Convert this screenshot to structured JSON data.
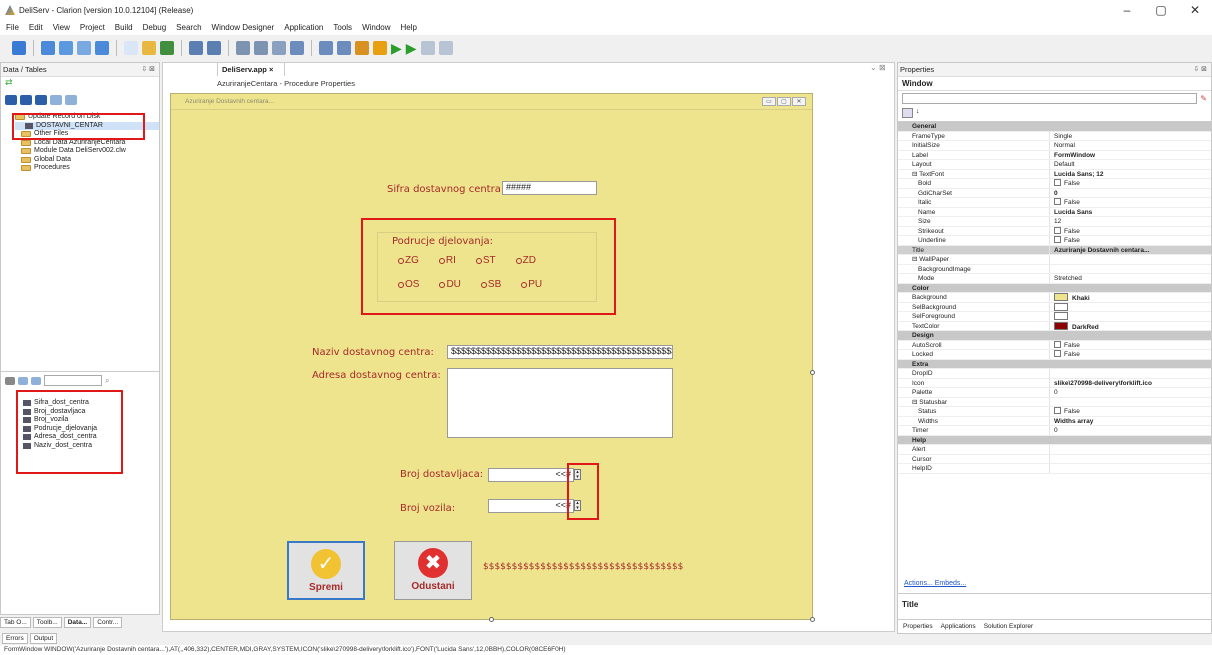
{
  "window": {
    "title": "DeliServ - Clarion [version 10.0.12104] (Release)",
    "minimize": "–",
    "maximize": "▢",
    "close": "✕"
  },
  "menu": [
    "File",
    "Edit",
    "View",
    "Project",
    "Build",
    "Debug",
    "Search",
    "Window Designer",
    "Application",
    "Tools",
    "Window",
    "Help"
  ],
  "left_panel": {
    "title": "Data / Tables",
    "tree": [
      "Update Record on Disk",
      "DOSTAVNI_CENTAR",
      "Other Files",
      "Local Data AzuriranjeCentara",
      "Module Data DeliServ002.clw",
      "Global Data",
      "Procedures"
    ],
    "fields": [
      "Sifra_dost_centra",
      "Broj_dostavljaca",
      "Broj_vozila",
      "Podrucje_djelovanja",
      "Adresa_dost_centra",
      "Naziv_dost_centra"
    ],
    "bottom_tabs": [
      "Tab O...",
      "Toolb...",
      "Data...",
      "Contr..."
    ]
  },
  "document": {
    "tab_label": "DeliServ.app",
    "tab_close": "×",
    "breadcrumb": "AzuriranjeCentara - Procedure Properties"
  },
  "form": {
    "title": "Azuriranje Dostavnih centara...",
    "sifra_label": "Sifra dostavnog centra:",
    "sifra_value": "#####",
    "group_label": "Podrucje djelovanja:",
    "radios_row1": [
      "ZG",
      "RI",
      "ST",
      "ZD"
    ],
    "radios_row2": [
      "OS",
      "DU",
      "SB",
      "PU"
    ],
    "naziv_label": "Naziv dostavnog centra:",
    "naziv_value": "$$$$$$$$$$$$$$$$$$$$$$$$$$$$$$$$$$$$$$$$$$$$$$$$$$$$$$$$$$$$$",
    "adresa_label": "Adresa dostavnog centra:",
    "broj_dostavljaca_label": "Broj dostavljaca:",
    "broj_dostavljaca_value": "<<#",
    "broj_vozila_label": "Broj vozila:",
    "broj_vozila_value": "<<#",
    "save_label": "Spremi",
    "cancel_label": "Odustani",
    "string_placeholder": "$$$$$$$$$$$$$$$$$$$$$$$$$$$$$$$$$$$"
  },
  "properties": {
    "title": "Properties",
    "object": "Window",
    "rows": [
      {
        "n": "General",
        "cat": true
      },
      {
        "n": "FrameType",
        "v": "Single"
      },
      {
        "n": "InitialSize",
        "v": "Normal"
      },
      {
        "n": "Label",
        "v": "FormWindow",
        "b": true
      },
      {
        "n": "Layout",
        "v": "Default"
      },
      {
        "n": "⊟ TextFont",
        "v": "Lucida Sans; 12",
        "b": true
      },
      {
        "n": "Bold",
        "v": "False",
        "cb": true,
        "ind": true
      },
      {
        "n": "GdiCharSet",
        "v": "0",
        "b": true,
        "ind": true
      },
      {
        "n": "Italic",
        "v": "False",
        "cb": true,
        "ind": true
      },
      {
        "n": "Name",
        "v": "Lucida Sans",
        "b": true,
        "ind": true
      },
      {
        "n": "Size",
        "v": "12",
        "ind": true
      },
      {
        "n": "Strikeout",
        "v": "False",
        "cb": true,
        "ind": true
      },
      {
        "n": "Underline",
        "v": "False",
        "cb": true,
        "ind": true
      },
      {
        "n": "Title",
        "v": "Azuriranje Dostavnih centara...",
        "b": true,
        "sel": true
      },
      {
        "n": "⊟ WallPaper",
        "v": ""
      },
      {
        "n": "BackgroundImage",
        "v": "",
        "ind": true
      },
      {
        "n": "Mode",
        "v": "Stretched",
        "ind": true
      },
      {
        "n": "Color",
        "cat": true
      },
      {
        "n": "Background",
        "v": "Khaki",
        "b": true,
        "sw": "#efe48e"
      },
      {
        "n": "SelBackground",
        "v": "",
        "sw": "#ffffff"
      },
      {
        "n": "SelForeground",
        "v": "",
        "sw": "#ffffff"
      },
      {
        "n": "TextColor",
        "v": "DarkRed",
        "b": true,
        "sw": "#8b0000"
      },
      {
        "n": "Design",
        "cat": true
      },
      {
        "n": "AutoScroll",
        "v": "False",
        "cb": true
      },
      {
        "n": "Locked",
        "v": "False",
        "cb": true
      },
      {
        "n": "Extra",
        "cat": true
      },
      {
        "n": "DropID",
        "v": ""
      },
      {
        "n": "Icon",
        "v": "slike\\270998-delivery\\forklift.ico",
        "b": true
      },
      {
        "n": "Palette",
        "v": "0"
      },
      {
        "n": "⊟ Statusbar",
        "v": ""
      },
      {
        "n": "Status",
        "v": "False",
        "cb": true,
        "ind": true
      },
      {
        "n": "Widths",
        "v": "Widths array",
        "b": true,
        "ind": true
      },
      {
        "n": "Timer",
        "v": "0"
      },
      {
        "n": "Help",
        "cat": true
      },
      {
        "n": "Alert",
        "v": ""
      },
      {
        "n": "Cursor",
        "v": ""
      },
      {
        "n": "HelpID",
        "v": ""
      }
    ],
    "links": "Actions... Embeds...",
    "desc_title": "Title",
    "bottom_tabs": [
      "Properties",
      "Applications",
      "Solution Explorer"
    ]
  },
  "output_tabs": [
    "Errors",
    "Output"
  ],
  "statusbar": "FormWindow WINDOW('Azuriranje Dostavnih centara...'),AT(,,406,332),CENTER,MDI,GRAY,SYSTEM,ICON('slike\\270998-delivery\\forklift.ico'),FONT('Lucida Sans',12,0BBH),COLOR(08CE6F0H)"
}
